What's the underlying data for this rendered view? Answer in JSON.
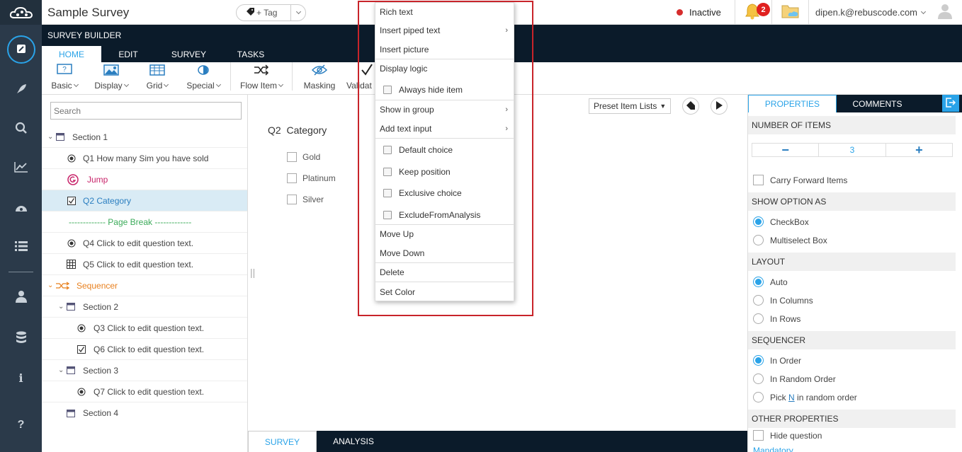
{
  "app": {
    "title": "Sample Survey",
    "tag_label": "+ Tag",
    "status": "Inactive",
    "notifications": "2",
    "user_email": "dipen.k@rebuscode.com"
  },
  "colors": {
    "accent": "#2aa3e8",
    "nav_bg": "#2b3a4a",
    "dark_band": "#0b1b2a",
    "status_red": "#d62d2d",
    "highlight_red": "#c8242a"
  },
  "leftnav": [
    "edit-icon",
    "rocket-icon",
    "search-icon",
    "chart-icon",
    "dashboard-icon",
    "list-icon",
    "user-icon",
    "database-icon",
    "info-icon",
    "help-icon"
  ],
  "builder": {
    "label": "SURVEY BUILDER",
    "tabs": [
      "HOME",
      "EDIT",
      "SURVEY",
      "TASKS"
    ]
  },
  "toolbar": {
    "basic": "Basic",
    "display": "Display",
    "grid": "Grid",
    "special": "Special",
    "flow_item": "Flow Item",
    "masking": "Masking",
    "validation": "Validat"
  },
  "tree": {
    "search_placeholder": "Search",
    "rows": [
      "Section 1",
      "Q1 How many Sim you have sold",
      "Jump",
      "Q2 Category",
      "------------- Page Break -------------",
      "Q4 Click to edit question text.",
      "Q5 Click to edit question text.",
      "Sequencer",
      "Section 2",
      "Q3 Click to edit question text.",
      "Q6 Click to edit question text.",
      "Section 3",
      "Q7 Click to edit question text.",
      "Section 4"
    ]
  },
  "canvas": {
    "preset_label": "Preset Item Lists",
    "question_number": "Q2",
    "question_text": "Category",
    "options": [
      "Gold",
      "Platinum",
      "Silver"
    ]
  },
  "bottom_tabs": [
    "SURVEY",
    "ANALYSIS"
  ],
  "properties": {
    "tabs": [
      "PROPERTIES",
      "COMMENTS"
    ],
    "number_of_items_label": "NUMBER OF ITEMS",
    "number_of_items_value": "3",
    "stepper_minus": "−",
    "stepper_plus": "+",
    "carry_forward": "Carry Forward Items",
    "show_option_as_label": "SHOW OPTION AS",
    "show_option_as": [
      "CheckBox",
      "Multiselect Box"
    ],
    "layout_label": "LAYOUT",
    "layout": [
      "Auto",
      "In Columns",
      "In Rows"
    ],
    "sequencer_label": "SEQUENCER",
    "sequencer": [
      "In Order",
      "In Random Order",
      "Pick",
      "N",
      "in random order"
    ],
    "other_label": "OTHER PROPERTIES",
    "hide_question": "Hide question",
    "mandatory": "Mandatory"
  },
  "context_menu": {
    "items": [
      "Rich text",
      "Insert piped text",
      "Insert picture",
      "Display logic",
      "Always hide item",
      "Show in group",
      "Add text input",
      "Default choice",
      "Keep position",
      "Exclusive choice",
      "ExcludeFromAnalysis",
      "Move Up",
      "Move Down",
      "Delete",
      "Set Color"
    ],
    "submenu_arrow": "›"
  }
}
